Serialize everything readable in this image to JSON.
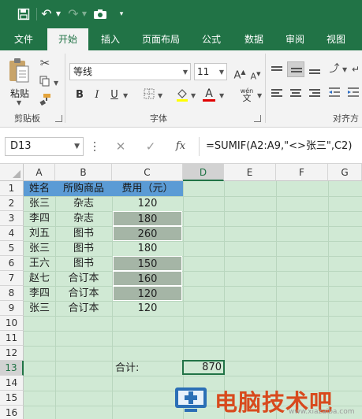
{
  "tabs": [
    "文件",
    "开始",
    "插入",
    "页面布局",
    "公式",
    "数据",
    "审阅",
    "视图"
  ],
  "active_tab": "开始",
  "clipboard": {
    "paste_label": "粘贴",
    "group_label": "剪贴板"
  },
  "font": {
    "name": "等线",
    "size": "11",
    "group_label": "字体",
    "bold": "B",
    "italic": "I",
    "underline": "U",
    "font_color": "A",
    "phonetic": "wén"
  },
  "alignment": {
    "group_label": "对齐方"
  },
  "formula_bar": {
    "name_box": "D13",
    "cancel": "✕",
    "enter": "✓",
    "fx": "fx",
    "formula": "=SUMIF(A2:A9,\"<>张三\",C2)"
  },
  "columns": [
    "A",
    "B",
    "C",
    "D",
    "E",
    "F",
    "G"
  ],
  "rows": [
    "1",
    "2",
    "3",
    "4",
    "5",
    "6",
    "7",
    "8",
    "9",
    "10",
    "11",
    "12",
    "13",
    "14",
    "15",
    "16"
  ],
  "sheet": {
    "headers": [
      "姓名",
      "所购商品",
      "费用（元）"
    ],
    "data": [
      [
        "张三",
        "杂志",
        "120"
      ],
      [
        "李四",
        "杂志",
        "180"
      ],
      [
        "刘五",
        "图书",
        "260"
      ],
      [
        "张三",
        "图书",
        "180"
      ],
      [
        "王六",
        "图书",
        "150"
      ],
      [
        "赵七",
        "合订本",
        "160"
      ],
      [
        "李四",
        "合订本",
        "120"
      ],
      [
        "张三",
        "合订本",
        "120"
      ]
    ],
    "total_label": "合计:",
    "total_value": "870"
  },
  "colors": {
    "ribbon_green": "#217346",
    "sheet_bg": "#d0e9d4",
    "header_fill": "#5b9bd5",
    "highlight_fill": "#a5b5a6"
  },
  "watermark": {
    "text": "电脑技术吧",
    "url": "www.xiazaiba.com"
  }
}
